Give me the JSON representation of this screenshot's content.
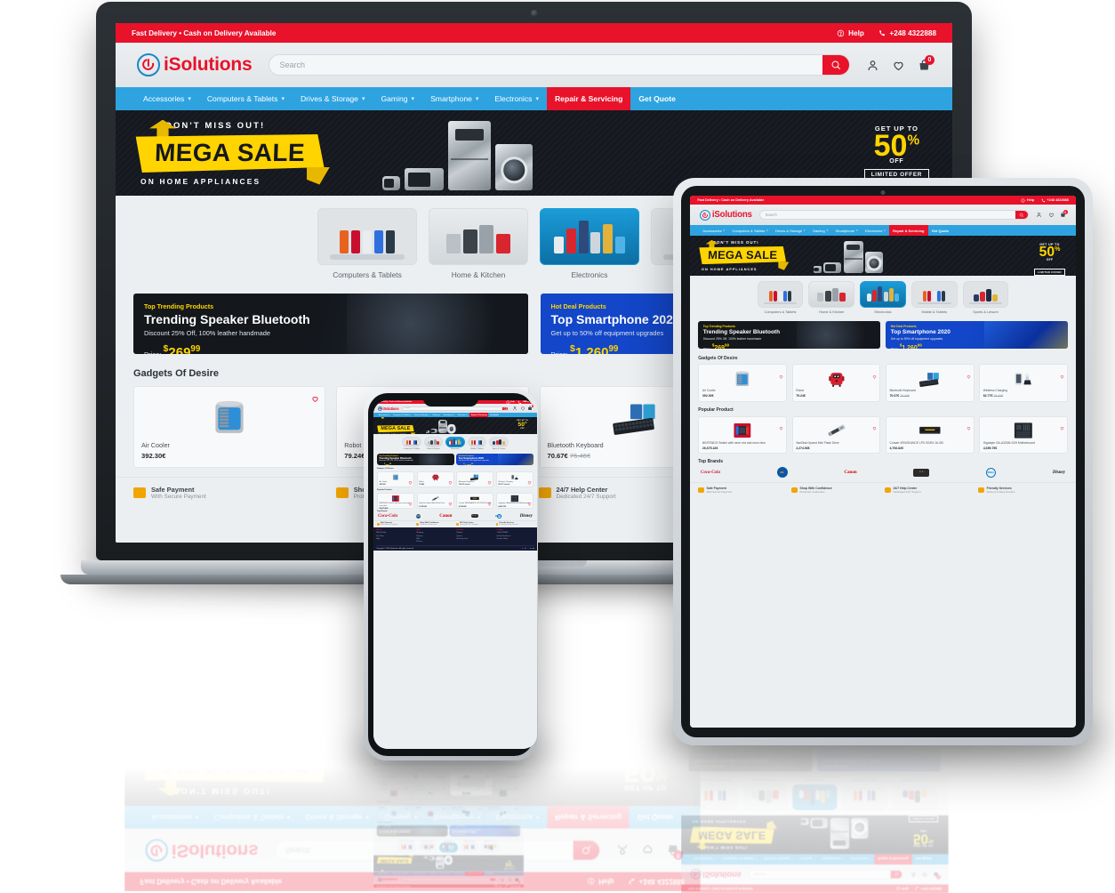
{
  "site": {
    "topbar": {
      "promo": "Fast Delivery • Cash on Delivery Available",
      "help": "Help",
      "phone": "+248 4322888",
      "help_icon": "help-circle-icon",
      "phone_icon": "phone-icon"
    },
    "brand": {
      "name": "iSolutions",
      "logo_icon": "power-button-icon",
      "color": "#e8122b",
      "ring_color": "#1b86c8"
    },
    "search": {
      "placeholder": "Search",
      "value": "",
      "button_icon": "search-icon"
    },
    "header_icons": [
      {
        "name": "account-icon",
        "glyph": "account"
      },
      {
        "name": "wishlist-icon",
        "glyph": "heart"
      },
      {
        "name": "cart-icon",
        "glyph": "bag",
        "badge": "0"
      }
    ],
    "nav": [
      {
        "label": "Accessories",
        "dropdown": true,
        "style": "link"
      },
      {
        "label": "Computers & Tablets",
        "dropdown": true,
        "style": "link"
      },
      {
        "label": "Drives & Storage",
        "dropdown": true,
        "style": "link"
      },
      {
        "label": "Gaming",
        "dropdown": true,
        "style": "link"
      },
      {
        "label": "Smartphone",
        "dropdown": true,
        "style": "link"
      },
      {
        "label": "Electronics",
        "dropdown": true,
        "style": "link"
      },
      {
        "label": "Repair & Servicing",
        "dropdown": false,
        "style": "accent"
      },
      {
        "label": "Get Quote",
        "dropdown": false,
        "style": "plain"
      }
    ],
    "hero": {
      "kicker": "DON'T MISS OUT!",
      "title": "MEGA SALE",
      "subtitle": "ON HOME APPLIANCES",
      "offer_kicker": "GET UP TO",
      "offer_value": "50",
      "offer_pct": "%",
      "offer_off": "OFF",
      "offer_badge": "LIMITED OFFER"
    },
    "categories": [
      {
        "label": "Computers & Tablets",
        "style": "phones"
      },
      {
        "label": "Home & Kitchen",
        "style": "kitchen"
      },
      {
        "label": "Electronics",
        "style": "electronics"
      },
      {
        "label": "Mobile & Tablets",
        "style": "phones"
      },
      {
        "label": "Sports & Leisure",
        "style": "sports"
      }
    ],
    "promos": [
      {
        "tag": "Top Trending Products",
        "title": "Trending Speaker Bluetooth",
        "subtitle": "Discount 25% Off, 100% leather handmade",
        "price_label": "Price:",
        "currency": "$",
        "price": "269",
        "decimals": "99",
        "theme": "dark"
      },
      {
        "tag": "Hot Deal Products",
        "title": "Top Smartphone 2020",
        "subtitle": "Get up to 50% off equipment upgrades",
        "price_label": "Price:",
        "currency": "$",
        "price": "1.260",
        "decimals": "99",
        "theme": "blue"
      }
    ],
    "gadgets_section": {
      "heading": "Gadgets Of Desire",
      "products": [
        {
          "name": "Air Cooler",
          "price": "392.30€",
          "old_price": "",
          "image": "air-cooler"
        },
        {
          "name": "Robot",
          "price": "79.24€",
          "old_price": "",
          "image": "robot"
        },
        {
          "name": "Bluetooth Keyboard",
          "price": "70.67€",
          "old_price": "76.46€",
          "image": "keyboard"
        },
        {
          "name": "Wireless Charging",
          "price": "62.77€",
          "old_price": "76.46€",
          "image": "charger"
        }
      ]
    },
    "popular_section": {
      "heading": "Popular Product",
      "products": [
        {
          "name": "NINTENDO Switch with neon red and neon blue",
          "price": "26,675.42€",
          "old_price": "",
          "image": "switch"
        },
        {
          "name": "SanDisk iXpand Mini Flash Drive",
          "price": "2,274.56€",
          "old_price": "",
          "image": "usb"
        },
        {
          "name": "Corsair VENGEANCE LPX DDR4 16-GB",
          "price": "4,706.82€",
          "old_price": "",
          "image": "ram"
        },
        {
          "name": "Gigabyte GA-A320M-S2H Motherboard",
          "price": "4,659.75€",
          "old_price": "",
          "image": "mobo"
        }
      ]
    },
    "brands_section": {
      "heading": "Top Brands",
      "brands": [
        {
          "name": "Coca-Cola",
          "color": "#c8102e"
        },
        {
          "name": "Burger King",
          "color": "#f5a623"
        },
        {
          "name": "Canon",
          "color": "#cc0000"
        },
        {
          "name": "Harley-Davidson",
          "color": "#2b2b2b"
        },
        {
          "name": "Dell",
          "color": "#0076ce"
        },
        {
          "name": "Disney",
          "color": "#111111"
        }
      ]
    },
    "services": [
      {
        "title": "Safe Payment",
        "desc": "With Secure Payment",
        "icon": "wallet-icon"
      },
      {
        "title": "Shop With Confidence",
        "desc": "Protection Guarantee",
        "icon": "handshake-icon"
      },
      {
        "title": "24/7 Help Center",
        "desc": "Dedicated 24/7 Support",
        "icon": "headset-icon"
      },
      {
        "title": "Friendly Services",
        "desc": "Delivery & Easy Returns",
        "icon": "gift-icon"
      }
    ],
    "footer": {
      "columns": [
        {
          "heading": "About",
          "links": [
            "Who We Are",
            "Our Store",
            "Blog"
          ]
        },
        {
          "heading": "Help",
          "links": [
            "Shipping",
            "Delivery",
            "FAQ",
            "Returns"
          ]
        },
        {
          "heading": "Services",
          "links": [
            "Repairs",
            "Quotes",
            "Warranty Care"
          ]
        },
        {
          "heading": "Contact",
          "links": [
            "+248 4322888",
            "info@isolutions.sc",
            "Victoria, Mahe"
          ]
        }
      ],
      "copyright": "Copyright © 2020 iSolutions. All rights reserved.",
      "payments": [
        "visa",
        "mastercard",
        "amex",
        "paypal",
        "maestro",
        "discover"
      ]
    }
  },
  "devices": [
    {
      "name": "laptop",
      "label": "Laptop"
    },
    {
      "name": "tablet",
      "label": "Tablet"
    },
    {
      "name": "phone",
      "label": "Smartphone"
    }
  ]
}
